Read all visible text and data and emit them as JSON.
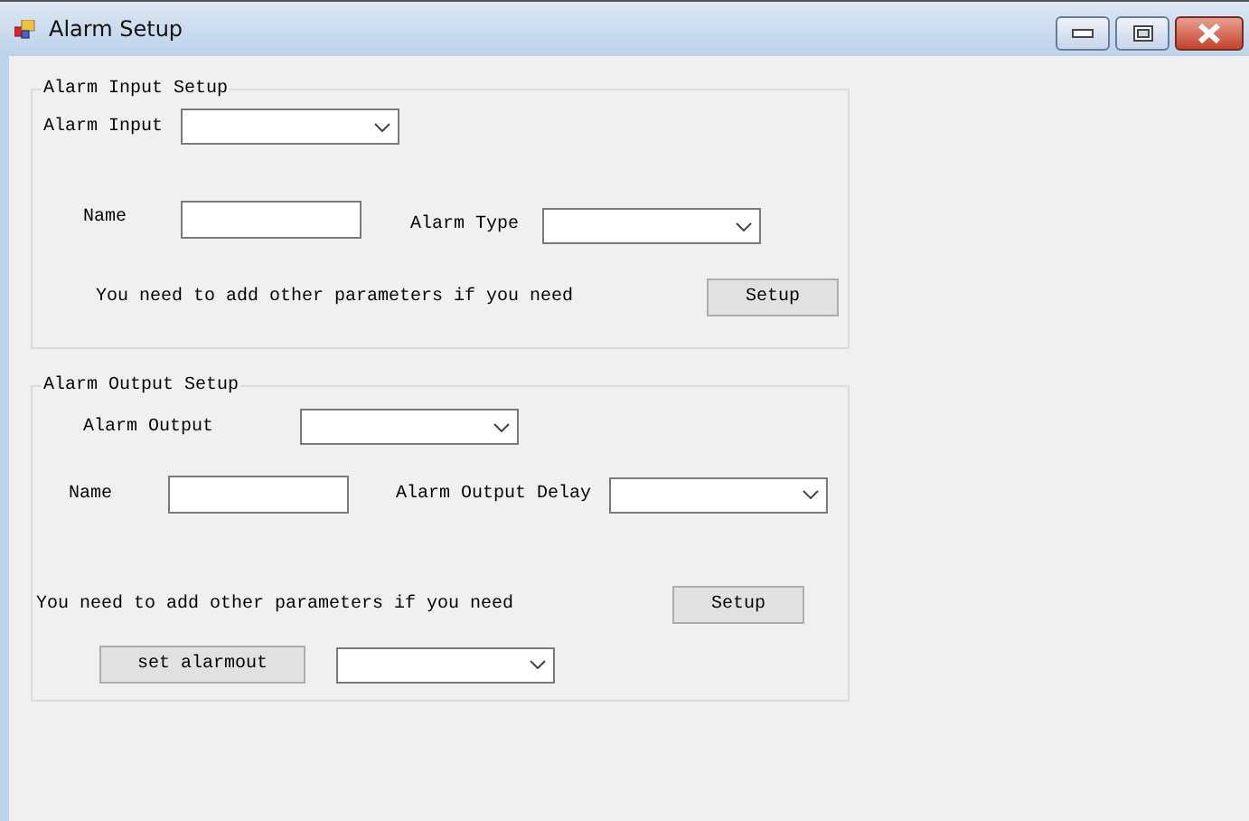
{
  "window": {
    "title": "Alarm Setup"
  },
  "alarm_input_setup": {
    "title": "Alarm Input Setup",
    "alarm_input": {
      "label": "Alarm Input"
    },
    "name": {
      "label": "Name"
    },
    "alarm_type": {
      "label": "Alarm Type"
    },
    "note": "You need to add other parameters if you need",
    "setup_button": "Setup"
  },
  "alarm_output_setup": {
    "title": "Alarm Output Setup",
    "alarm_output": {
      "label": "Alarm Output"
    },
    "name": {
      "label": "Name"
    },
    "alarm_output_delay": {
      "label": "Alarm Output Delay"
    },
    "note": "You need to add other parameters if you need",
    "setup_button": "Setup",
    "set_alarmout_button": "set alarmout"
  }
}
